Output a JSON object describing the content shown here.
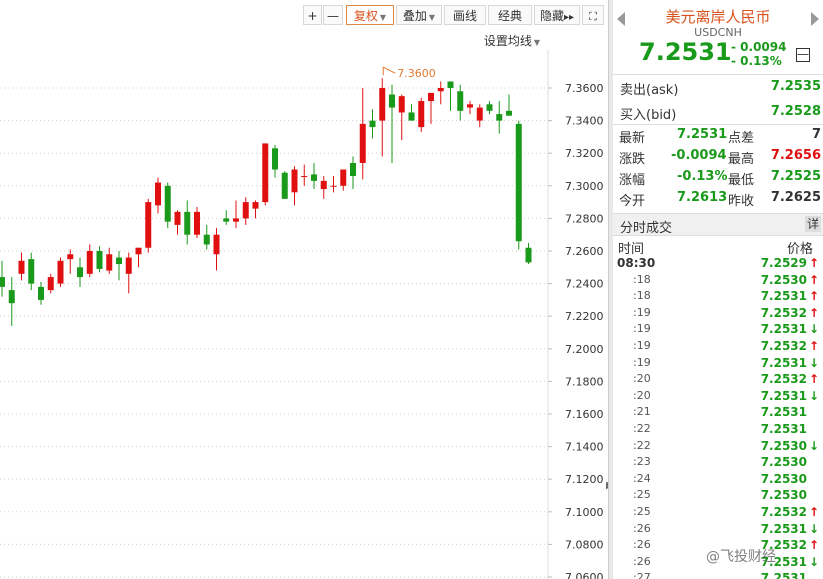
{
  "toolbar": {
    "plus": "+",
    "minus": "—",
    "restore_rights": "复权",
    "overlay": "叠加",
    "draw_line": "画线",
    "classic": "经典",
    "hide": "隐藏",
    "more_arrows": "▸▸",
    "fullscreen_icon": "fullscreen-icon"
  },
  "ma_setting": "设置均线",
  "chart_data": {
    "type": "candlestick",
    "yaxis_ticks": [
      "7.3600",
      "7.3400",
      "7.3200",
      "7.3000",
      "7.2800",
      "7.2600",
      "7.2400",
      "7.2200",
      "7.2000",
      "7.1800",
      "7.1600",
      "7.1400",
      "7.1200",
      "7.1000",
      "7.0800",
      "7.0600"
    ],
    "ylim": [
      7.06,
      7.38
    ],
    "annotation": "7.3600",
    "candles": [
      {
        "o": 7.244,
        "h": 7.254,
        "l": 7.232,
        "c": 7.238
      },
      {
        "o": 7.236,
        "h": 7.244,
        "l": 7.214,
        "c": 7.228
      },
      {
        "o": 7.246,
        "h": 7.259,
        "l": 7.242,
        "c": 7.254
      },
      {
        "o": 7.255,
        "h": 7.259,
        "l": 7.236,
        "c": 7.24
      },
      {
        "o": 7.238,
        "h": 7.241,
        "l": 7.227,
        "c": 7.23
      },
      {
        "o": 7.236,
        "h": 7.246,
        "l": 7.234,
        "c": 7.244
      },
      {
        "o": 7.24,
        "h": 7.256,
        "l": 7.238,
        "c": 7.254
      },
      {
        "o": 7.255,
        "h": 7.261,
        "l": 7.246,
        "c": 7.258
      },
      {
        "o": 7.25,
        "h": 7.256,
        "l": 7.238,
        "c": 7.244
      },
      {
        "o": 7.246,
        "h": 7.264,
        "l": 7.244,
        "c": 7.26
      },
      {
        "o": 7.26,
        "h": 7.263,
        "l": 7.247,
        "c": 7.249
      },
      {
        "o": 7.248,
        "h": 7.262,
        "l": 7.246,
        "c": 7.258
      },
      {
        "o": 7.256,
        "h": 7.26,
        "l": 7.242,
        "c": 7.252
      },
      {
        "o": 7.246,
        "h": 7.259,
        "l": 7.234,
        "c": 7.256
      },
      {
        "o": 7.258,
        "h": 7.262,
        "l": 7.25,
        "c": 7.262
      },
      {
        "o": 7.262,
        "h": 7.292,
        "l": 7.259,
        "c": 7.29
      },
      {
        "o": 7.288,
        "h": 7.305,
        "l": 7.283,
        "c": 7.302
      },
      {
        "o": 7.3,
        "h": 7.302,
        "l": 7.274,
        "c": 7.278
      },
      {
        "o": 7.276,
        "h": 7.285,
        "l": 7.27,
        "c": 7.284
      },
      {
        "o": 7.284,
        "h": 7.291,
        "l": 7.264,
        "c": 7.27
      },
      {
        "o": 7.27,
        "h": 7.287,
        "l": 7.268,
        "c": 7.284
      },
      {
        "o": 7.27,
        "h": 7.276,
        "l": 7.261,
        "c": 7.264
      },
      {
        "o": 7.258,
        "h": 7.274,
        "l": 7.248,
        "c": 7.27
      },
      {
        "o": 7.28,
        "h": 7.285,
        "l": 7.276,
        "c": 7.278
      },
      {
        "o": 7.278,
        "h": 7.291,
        "l": 7.274,
        "c": 7.28
      },
      {
        "o": 7.28,
        "h": 7.293,
        "l": 7.276,
        "c": 7.29
      },
      {
        "o": 7.286,
        "h": 7.291,
        "l": 7.28,
        "c": 7.29
      },
      {
        "o": 7.29,
        "h": 7.326,
        "l": 7.288,
        "c": 7.326
      },
      {
        "o": 7.323,
        "h": 7.325,
        "l": 7.305,
        "c": 7.31
      },
      {
        "o": 7.308,
        "h": 7.309,
        "l": 7.292,
        "c": 7.292
      },
      {
        "o": 7.296,
        "h": 7.312,
        "l": 7.288,
        "c": 7.31
      },
      {
        "o": 7.306,
        "h": 7.313,
        "l": 7.3,
        "c": 7.306
      },
      {
        "o": 7.307,
        "h": 7.314,
        "l": 7.298,
        "c": 7.303
      },
      {
        "o": 7.298,
        "h": 7.306,
        "l": 7.292,
        "c": 7.303
      },
      {
        "o": 7.3,
        "h": 7.306,
        "l": 7.296,
        "c": 7.3
      },
      {
        "o": 7.3,
        "h": 7.31,
        "l": 7.297,
        "c": 7.31
      },
      {
        "o": 7.314,
        "h": 7.318,
        "l": 7.298,
        "c": 7.306
      },
      {
        "o": 7.314,
        "h": 7.36,
        "l": 7.304,
        "c": 7.338
      },
      {
        "o": 7.34,
        "h": 7.347,
        "l": 7.329,
        "c": 7.336
      },
      {
        "o": 7.34,
        "h": 7.366,
        "l": 7.318,
        "c": 7.36
      },
      {
        "o": 7.356,
        "h": 7.362,
        "l": 7.314,
        "c": 7.348
      },
      {
        "o": 7.345,
        "h": 7.356,
        "l": 7.328,
        "c": 7.355
      },
      {
        "o": 7.345,
        "h": 7.35,
        "l": 7.34,
        "c": 7.34
      },
      {
        "o": 7.336,
        "h": 7.354,
        "l": 7.333,
        "c": 7.352
      },
      {
        "o": 7.352,
        "h": 7.356,
        "l": 7.338,
        "c": 7.357
      },
      {
        "o": 7.358,
        "h": 7.364,
        "l": 7.35,
        "c": 7.36
      },
      {
        "o": 7.364,
        "h": 7.364,
        "l": 7.346,
        "c": 7.36
      },
      {
        "o": 7.358,
        "h": 7.362,
        "l": 7.34,
        "c": 7.346
      },
      {
        "o": 7.348,
        "h": 7.352,
        "l": 7.344,
        "c": 7.35
      },
      {
        "o": 7.34,
        "h": 7.35,
        "l": 7.336,
        "c": 7.348
      },
      {
        "o": 7.35,
        "h": 7.352,
        "l": 7.344,
        "c": 7.346
      },
      {
        "o": 7.344,
        "h": 7.352,
        "l": 7.332,
        "c": 7.34
      },
      {
        "o": 7.346,
        "h": 7.356,
        "l": 7.343,
        "c": 7.343
      },
      {
        "o": 7.338,
        "h": 7.34,
        "l": 7.261,
        "c": 7.266
      },
      {
        "o": 7.262,
        "h": 7.265,
        "l": 7.252,
        "c": 7.253
      }
    ]
  },
  "quote": {
    "title": "美元离岸人民币",
    "code": "USDCNH",
    "price": "7.2531",
    "change": "- 0.0094",
    "pct": "- 0.13%",
    "minus_btn": "—",
    "ask_label": "卖出(ask)",
    "ask_value": "7.2535",
    "bid_label": "买入(bid)",
    "bid_value": "7.2528",
    "stats": [
      {
        "l1": "最新",
        "v1": "7.2531",
        "l2": "点差",
        "v2": "7"
      },
      {
        "l1": "涨跌",
        "v1": "-0.0094",
        "l2": "最高",
        "v2": "7.2656"
      },
      {
        "l1": "涨幅",
        "v1": "-0.13%",
        "l2": "最低",
        "v2": "7.2525"
      },
      {
        "l1": "今开",
        "v1": "7.2613",
        "l2": "昨收",
        "v2": "7.2625"
      }
    ],
    "colors": {
      "up": "#e01010",
      "down": "#1a9a1a",
      "neutral": "#333333"
    }
  },
  "trades": {
    "title": "分时成交",
    "detail": "详",
    "col_time": "时间",
    "col_price": "价格",
    "rows": [
      {
        "time": "08:30",
        "price": "7.2529",
        "dir": "up"
      },
      {
        "time": ":18",
        "price": "7.2530",
        "dir": "up"
      },
      {
        "time": ":18",
        "price": "7.2531",
        "dir": "up"
      },
      {
        "time": ":19",
        "price": "7.2532",
        "dir": "up"
      },
      {
        "time": ":19",
        "price": "7.2531",
        "dir": "down"
      },
      {
        "time": ":19",
        "price": "7.2532",
        "dir": "up"
      },
      {
        "time": ":19",
        "price": "7.2531",
        "dir": "down"
      },
      {
        "time": ":20",
        "price": "7.2532",
        "dir": "up"
      },
      {
        "time": ":20",
        "price": "7.2531",
        "dir": "down"
      },
      {
        "time": ":21",
        "price": "7.2531",
        "dir": ""
      },
      {
        "time": ":22",
        "price": "7.2531",
        "dir": ""
      },
      {
        "time": ":22",
        "price": "7.2530",
        "dir": "down"
      },
      {
        "time": ":23",
        "price": "7.2530",
        "dir": ""
      },
      {
        "time": ":24",
        "price": "7.2530",
        "dir": ""
      },
      {
        "time": ":25",
        "price": "7.2530",
        "dir": ""
      },
      {
        "time": ":25",
        "price": "7.2532",
        "dir": "up"
      },
      {
        "time": ":26",
        "price": "7.2531",
        "dir": "down"
      },
      {
        "time": ":26",
        "price": "7.2532",
        "dir": "up"
      },
      {
        "time": ":26",
        "price": "7.2531",
        "dir": "down"
      },
      {
        "time": ":27",
        "price": "7.2531",
        "dir": ""
      }
    ]
  },
  "watermark": "@飞投财经"
}
